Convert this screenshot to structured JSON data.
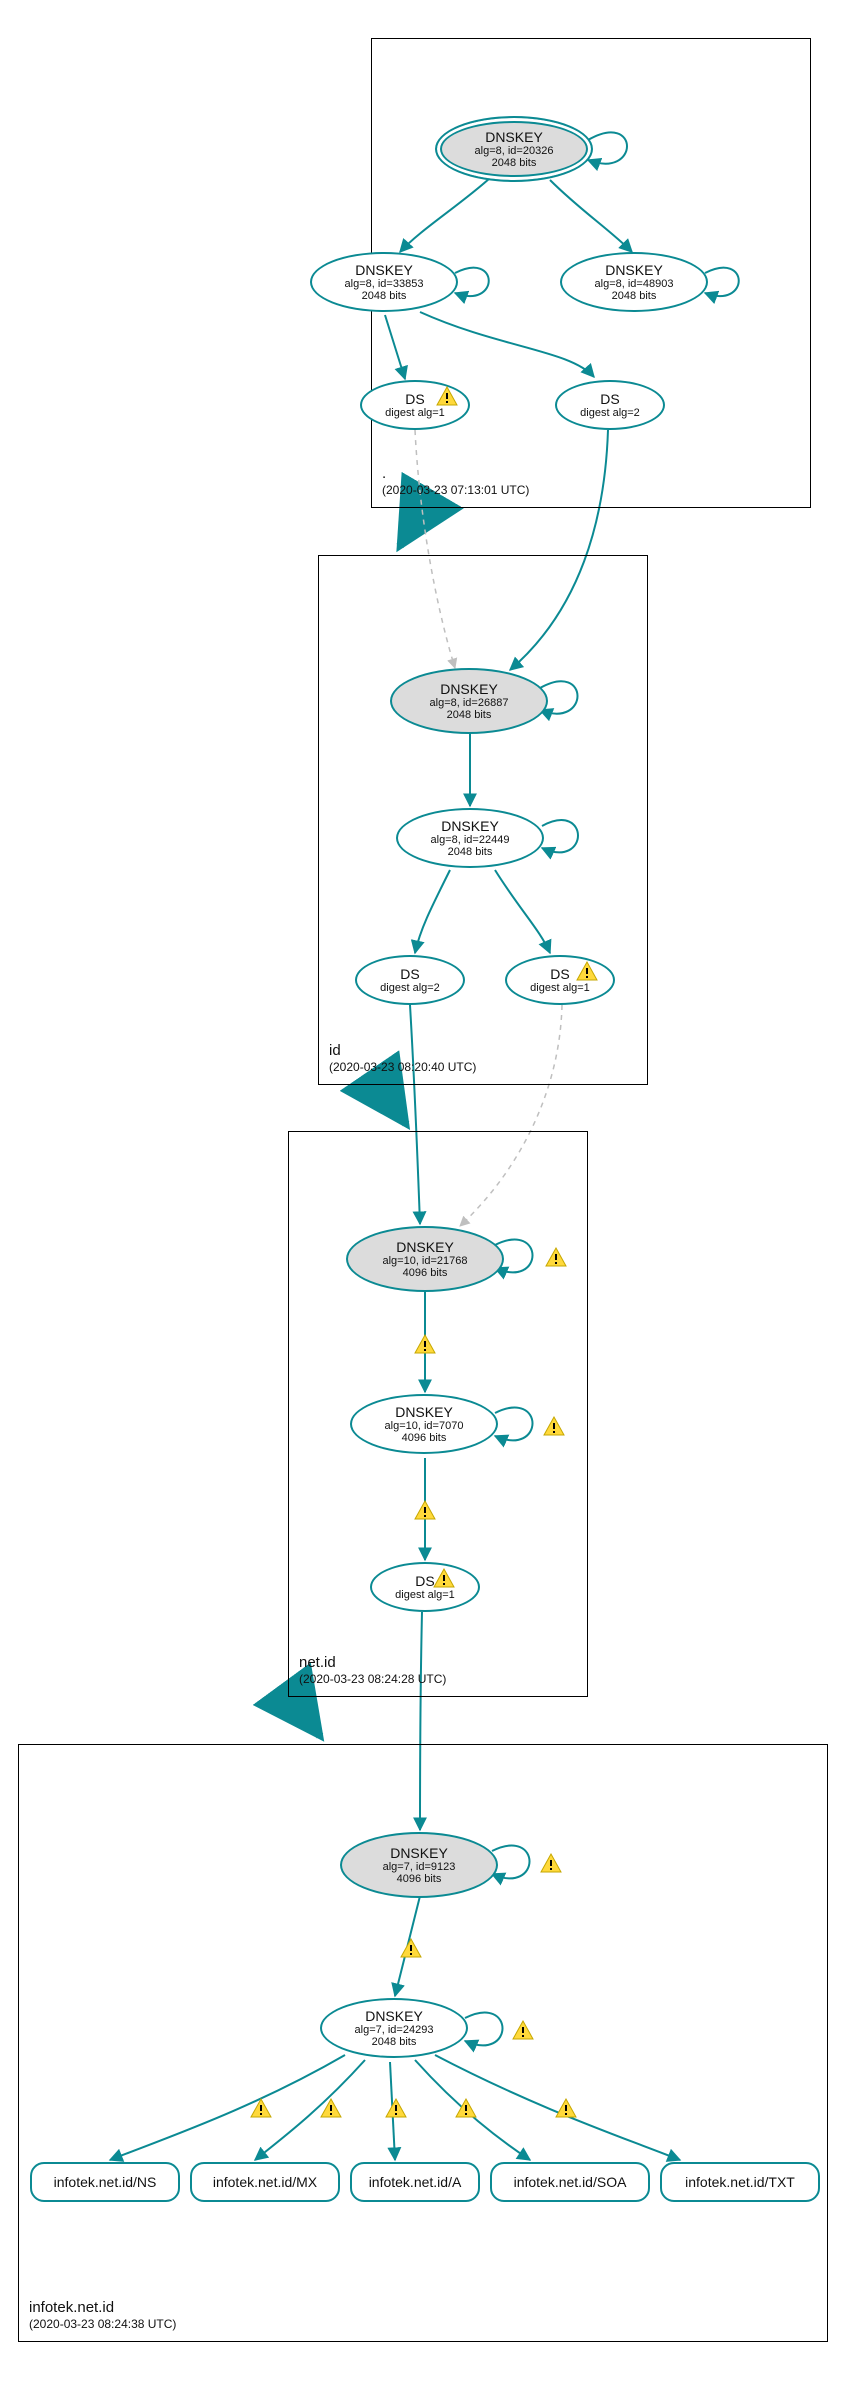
{
  "zones": {
    "root": {
      "name": ".",
      "timestamp": "(2020-03-23 07:13:01 UTC)",
      "nodes": {
        "ksk": {
          "title": "DNSKEY",
          "line2": "alg=8, id=20326",
          "line3": "2048 bits"
        },
        "zsk1": {
          "title": "DNSKEY",
          "line2": "alg=8, id=33853",
          "line3": "2048 bits"
        },
        "zsk2": {
          "title": "DNSKEY",
          "line2": "alg=8, id=48903",
          "line3": "2048 bits"
        },
        "ds1": {
          "title": "DS",
          "line2": "digest alg=1"
        },
        "ds2": {
          "title": "DS",
          "line2": "digest alg=2"
        }
      }
    },
    "id": {
      "name": "id",
      "timestamp": "(2020-03-23 08:20:40 UTC)",
      "nodes": {
        "ksk": {
          "title": "DNSKEY",
          "line2": "alg=8, id=26887",
          "line3": "2048 bits"
        },
        "zsk": {
          "title": "DNSKEY",
          "line2": "alg=8, id=22449",
          "line3": "2048 bits"
        },
        "ds1": {
          "title": "DS",
          "line2": "digest alg=2"
        },
        "ds2": {
          "title": "DS",
          "line2": "digest alg=1"
        }
      }
    },
    "netid": {
      "name": "net.id",
      "timestamp": "(2020-03-23 08:24:28 UTC)",
      "nodes": {
        "ksk": {
          "title": "DNSKEY",
          "line2": "alg=10, id=21768",
          "line3": "4096 bits"
        },
        "zsk": {
          "title": "DNSKEY",
          "line2": "alg=10, id=7070",
          "line3": "4096 bits"
        },
        "ds": {
          "title": "DS",
          "line2": "digest alg=1"
        }
      }
    },
    "infotek": {
      "name": "infotek.net.id",
      "timestamp": "(2020-03-23 08:24:38 UTC)",
      "nodes": {
        "ksk": {
          "title": "DNSKEY",
          "line2": "alg=7, id=9123",
          "line3": "4096 bits"
        },
        "zsk": {
          "title": "DNSKEY",
          "line2": "alg=7, id=24293",
          "line3": "2048 bits"
        }
      },
      "leaves": {
        "ns": "infotek.net.id/NS",
        "mx": "infotek.net.id/MX",
        "a": "infotek.net.id/A",
        "soa": "infotek.net.id/SOA",
        "txt": "infotek.net.id/TXT"
      }
    }
  }
}
